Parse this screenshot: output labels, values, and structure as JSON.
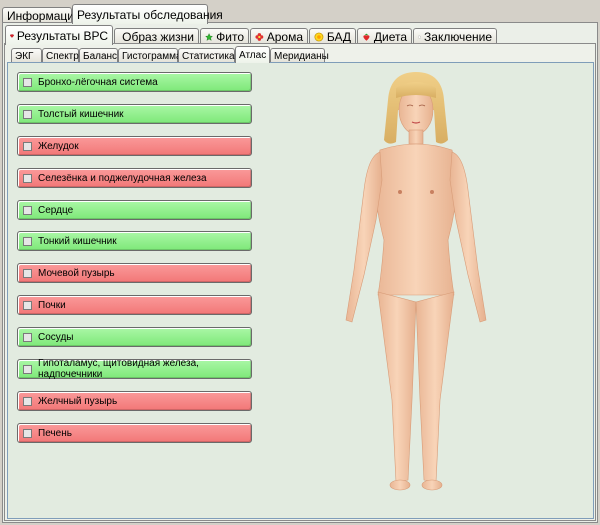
{
  "top_tabs": [
    {
      "label": "Информация",
      "active": false
    },
    {
      "label": "Результаты обследования",
      "active": true
    }
  ],
  "section_tabs": [
    {
      "label": "Результаты ВРС",
      "icon": "heart-icon",
      "active": true
    },
    {
      "label": "Образ жизни",
      "icon": "globe-icon",
      "active": false
    },
    {
      "label": "Фито",
      "icon": "leaf-icon",
      "active": false
    },
    {
      "label": "Арома",
      "icon": "flower-icon",
      "active": false
    },
    {
      "label": "БАД",
      "icon": "sun-icon",
      "active": false
    },
    {
      "label": "Диета",
      "icon": "strawberry-icon",
      "active": false
    },
    {
      "label": "Заключение",
      "icon": "document-icon",
      "active": false
    }
  ],
  "view_tabs": [
    {
      "label": "ЭКГ",
      "active": false
    },
    {
      "label": "Спектр",
      "active": false
    },
    {
      "label": "Баланс",
      "active": false
    },
    {
      "label": "Гистограмма",
      "active": false
    },
    {
      "label": "Статистика",
      "active": false
    },
    {
      "label": "Атлас",
      "active": true
    },
    {
      "label": "Меридианы",
      "active": false
    }
  ],
  "organs": [
    {
      "label": "Бронхо-лёгочная система",
      "status": "green"
    },
    {
      "label": "Толстый кишечник",
      "status": "green"
    },
    {
      "label": "Желудок",
      "status": "red"
    },
    {
      "label": "Селезёнка и поджелудочная железа",
      "status": "red"
    },
    {
      "label": "Сердце",
      "status": "green"
    },
    {
      "label": "Тонкий кишечник",
      "status": "green"
    },
    {
      "label": "Мочевой пузырь",
      "status": "red"
    },
    {
      "label": "Почки",
      "status": "red"
    },
    {
      "label": "Сосуды",
      "status": "green"
    },
    {
      "label": "Гипоталамус, щитовидная железа, надпочечники",
      "status": "green"
    },
    {
      "label": "Желчный пузырь",
      "status": "red"
    },
    {
      "label": "Печень",
      "status": "red"
    }
  ],
  "colors": {
    "ok_green": "#8cf088",
    "alert_red": "#f48484",
    "skin": "#f5c9a8",
    "hair": "#e8c27a"
  },
  "figure_icon": "female-body-figure"
}
